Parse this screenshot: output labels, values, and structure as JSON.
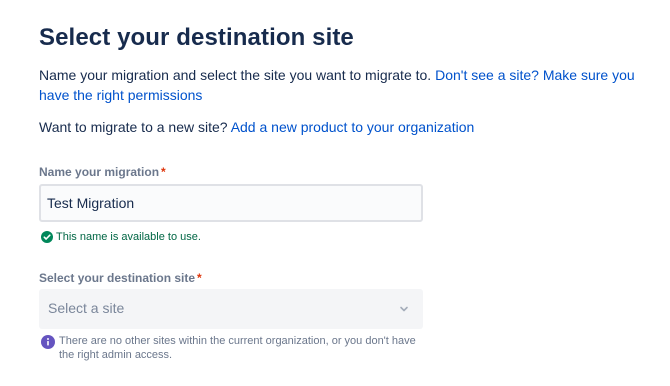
{
  "page": {
    "title": "Select your destination site",
    "intro_text": "Name your migration and select the site you want to migrate to. ",
    "intro_link": "Don't see a site? Make sure you have the right permissions",
    "new_site_text": "Want to migrate to a new site? ",
    "new_site_link": "Add a new product to your organization"
  },
  "migration_name": {
    "label": "Name your migration",
    "required_marker": "*",
    "value": "Test Migration",
    "validation_message": "This name is available to use.",
    "validation_icon": "check-circle-icon"
  },
  "destination_site": {
    "label": "Select your destination site",
    "required_marker": "*",
    "placeholder": "Select a site",
    "dropdown_icon": "chevron-down-icon",
    "info_message": "There are no other sites within the current organization, or you don't have the right admin access.",
    "info_icon": "info-icon"
  },
  "colors": {
    "link": "#0052cc",
    "success": "#006644",
    "info": "#6554c0",
    "required": "#de350b"
  }
}
